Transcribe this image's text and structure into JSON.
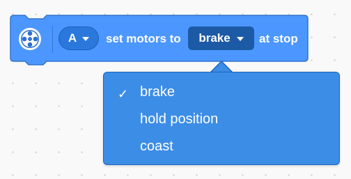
{
  "block": {
    "icon": "motor-icon",
    "port_label": "A",
    "text_before": "set motors to",
    "selected_mode": "brake",
    "text_after": "at stop"
  },
  "dropdown": {
    "options": [
      {
        "label": "brake",
        "selected": true
      },
      {
        "label": "hold position",
        "selected": false
      },
      {
        "label": "coast",
        "selected": false
      }
    ],
    "check_glyph": "✓"
  },
  "colors": {
    "block": "#4c97ff",
    "block_border": "#3373cc",
    "pill": "#2a78dc",
    "select": "#1d5aa6",
    "dropdown": "#3c8de6",
    "background": "#f9f9f9"
  }
}
